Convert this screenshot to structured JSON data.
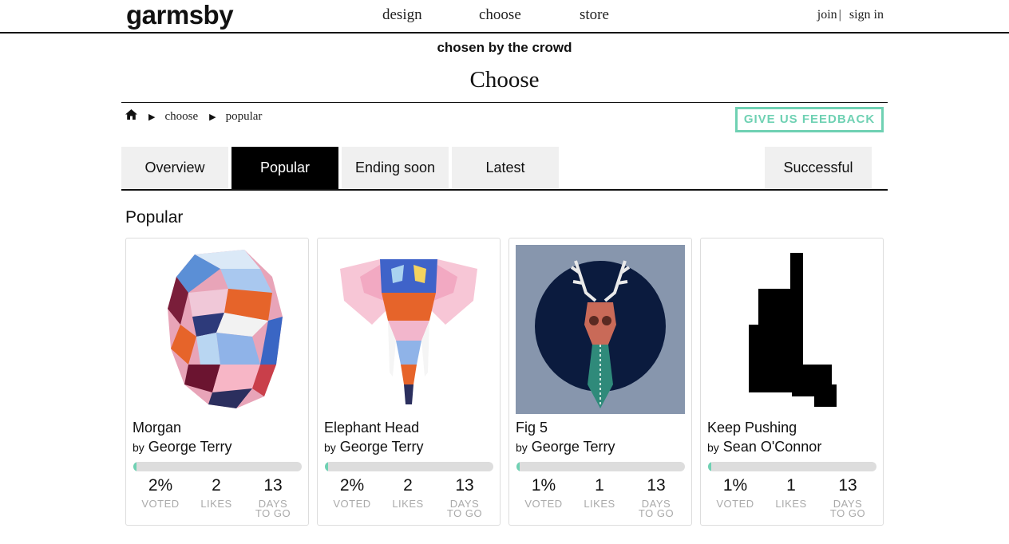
{
  "header": {
    "logo": "garmsby",
    "nav": [
      "design",
      "choose",
      "store"
    ],
    "join": "join",
    "separator": "|",
    "sign_in": "sign in"
  },
  "hero": {
    "tagline": "chosen by the crowd",
    "title": "Choose"
  },
  "breadcrumb": {
    "home_icon": "home-icon",
    "items": [
      "choose",
      "popular"
    ]
  },
  "feedback_button": "GIVE US FEEDBACK",
  "tabs": {
    "overview": "Overview",
    "popular": "Popular",
    "ending": "Ending soon",
    "latest": "Latest",
    "successful": "Successful",
    "active": "Popular"
  },
  "section_title": "Popular",
  "stat_labels": {
    "voted": "VOTED",
    "likes": "LIKES",
    "days_1": "DAYS",
    "days_2": "TO GO"
  },
  "accent_color": "#6fd1b3",
  "cards": [
    {
      "title": "Morgan",
      "by": "by",
      "author": "George Terry",
      "voted": "2%",
      "voted_fraction": 0.02,
      "likes": "2",
      "days": "13"
    },
    {
      "title": "Elephant Head",
      "by": "by",
      "author": "George Terry",
      "voted": "2%",
      "voted_fraction": 0.02,
      "likes": "2",
      "days": "13"
    },
    {
      "title": "Fig 5",
      "by": "by",
      "author": "George Terry",
      "voted": "1%",
      "voted_fraction": 0.01,
      "likes": "1",
      "days": "13"
    },
    {
      "title": "Keep Pushing",
      "by": "by",
      "author": "Sean O'Connor",
      "voted": "1%",
      "voted_fraction": 0.01,
      "likes": "1",
      "days": "13"
    }
  ]
}
